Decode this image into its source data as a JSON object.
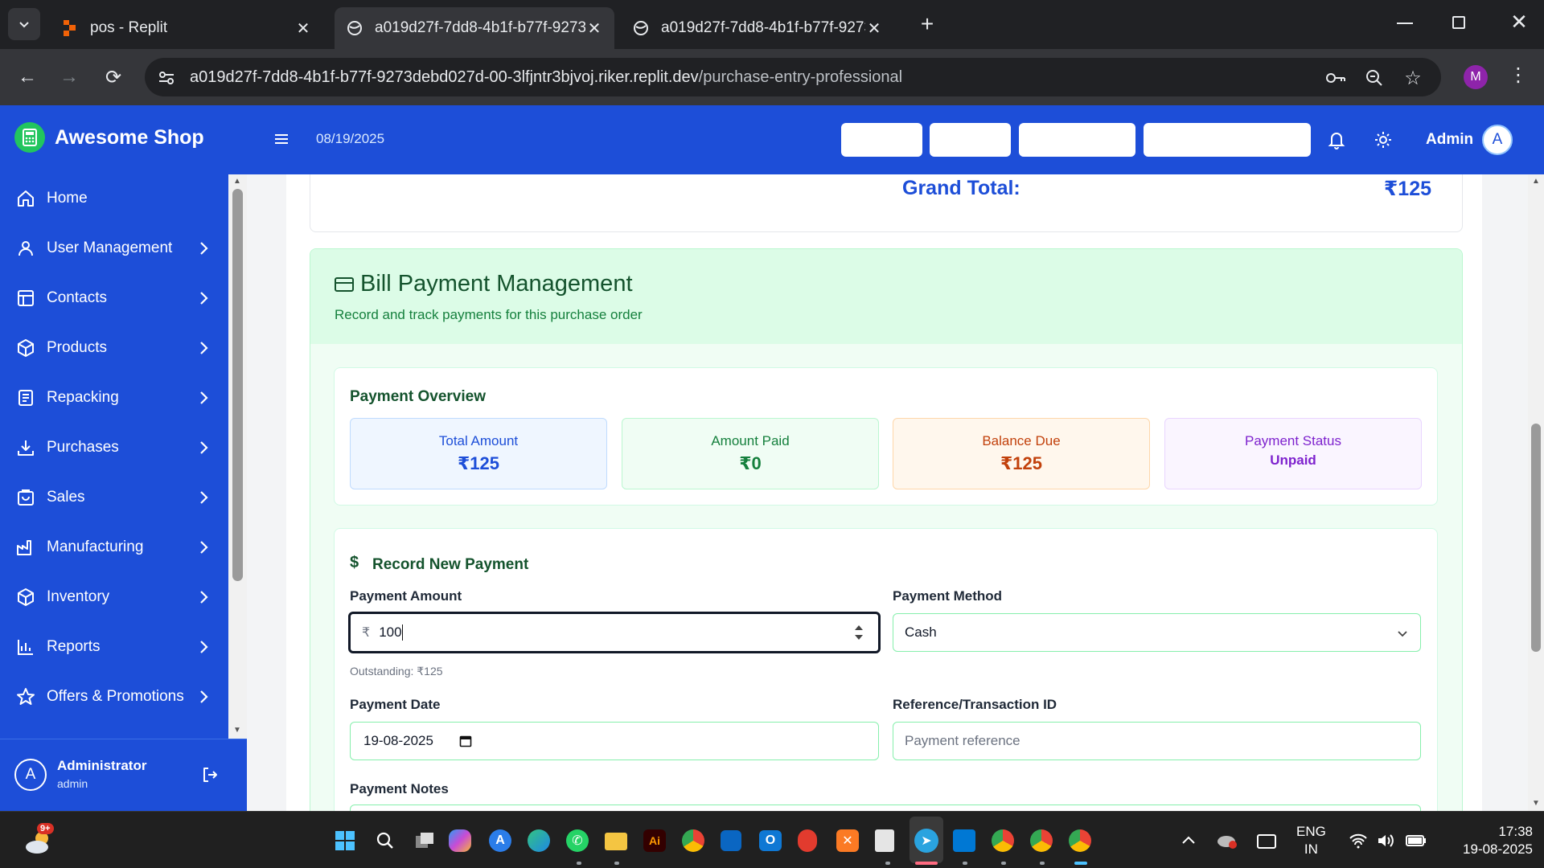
{
  "browser": {
    "tabs": [
      {
        "title": "pos - Replit",
        "favicon": "replit-icon"
      },
      {
        "title": "a019d27f-7dd8-4b1f-b77f-9273",
        "favicon": "globe-icon"
      },
      {
        "title": "a019d27f-7dd8-4b1f-b77f-9273",
        "favicon": "globe-icon"
      }
    ],
    "url_host": "a019d27f-7dd8-4b1f-b77f-9273debd027d-00-3lfjntr3bjvoj.riker.replit.dev",
    "url_path": "/purchase-entry-professional",
    "profile_initial": "M"
  },
  "header": {
    "brand": "Awesome Shop",
    "date": "08/19/2025",
    "admin": "Admin",
    "avatar_initial": "A"
  },
  "sidebar": {
    "items": [
      {
        "label": "Home",
        "icon": "home-icon"
      },
      {
        "label": "User Management",
        "icon": "user-icon"
      },
      {
        "label": "Contacts",
        "icon": "contacts-icon"
      },
      {
        "label": "Products",
        "icon": "box-icon"
      },
      {
        "label": "Repacking",
        "icon": "repack-icon"
      },
      {
        "label": "Purchases",
        "icon": "download-icon"
      },
      {
        "label": "Sales",
        "icon": "sales-icon"
      },
      {
        "label": "Manufacturing",
        "icon": "factory-icon"
      },
      {
        "label": "Inventory",
        "icon": "inventory-icon"
      },
      {
        "label": "Reports",
        "icon": "reports-icon"
      },
      {
        "label": "Offers & Promotions",
        "icon": "star-icon"
      }
    ],
    "user": {
      "name": "Administrator",
      "role": "admin",
      "initial": "A"
    }
  },
  "main": {
    "grand_total_label": "Grand Total:",
    "grand_total_value": "₹125",
    "bill_payment": {
      "title": "Bill Payment Management",
      "subtitle": "Record and track payments for this purchase order",
      "overview_title": "Payment Overview",
      "stats": [
        {
          "label": "Total Amount",
          "value": "₹125",
          "bg": "#eff6ff",
          "border": "#bfdbfe",
          "color": "#1d4ed8"
        },
        {
          "label": "Amount Paid",
          "value": "₹0",
          "bg": "#f0fdf4",
          "border": "#bbf7d0",
          "color": "#15803d"
        },
        {
          "label": "Balance Due",
          "value": "₹125",
          "bg": "#fff7ed",
          "border": "#fed7aa",
          "color": "#c2410c"
        },
        {
          "label": "Payment Status",
          "value": "Unpaid",
          "bg": "#faf5ff",
          "border": "#e9d5ff",
          "color": "#7e22ce"
        }
      ],
      "record_title": "Record New Payment",
      "record_icon": "$",
      "amount_label": "Payment Amount",
      "amount_prefix": "₹",
      "amount_value": "100",
      "outstanding": "Outstanding: ₹125",
      "method_label": "Payment Method",
      "method_value": "Cash",
      "date_label": "Payment Date",
      "date_value": "19-08-2025",
      "reference_label": "Reference/Transaction ID",
      "reference_placeholder": "Payment reference",
      "notes_label": "Payment Notes"
    }
  },
  "taskbar": {
    "weather_badge": "9+",
    "lang_line1": "ENG",
    "lang_line2": "IN",
    "time": "17:38",
    "date": "19-08-2025"
  }
}
